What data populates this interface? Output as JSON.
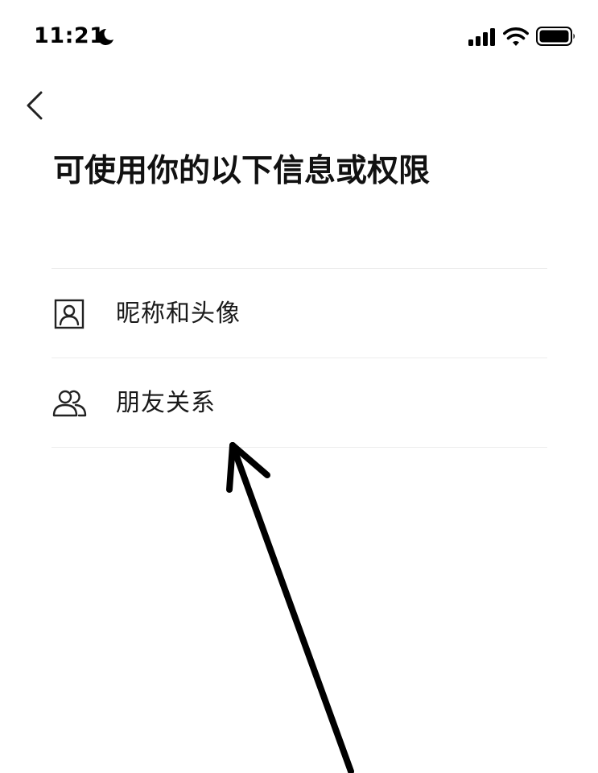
{
  "status_bar": {
    "time": "11:21",
    "moon_icon": "moon-icon",
    "signal_icon": "cellular-signal-icon",
    "wifi_icon": "wifi-icon",
    "battery_icon": "battery-icon"
  },
  "nav": {
    "back_icon": "chevron-left-icon"
  },
  "page": {
    "title": "可使用你的以下信息或权限"
  },
  "permissions": [
    {
      "icon": "id-card-person-icon",
      "label": "昵称和头像"
    },
    {
      "icon": "two-people-icon",
      "label": "朋友关系"
    }
  ],
  "annotation": {
    "icon": "hand-drawn-arrow"
  }
}
